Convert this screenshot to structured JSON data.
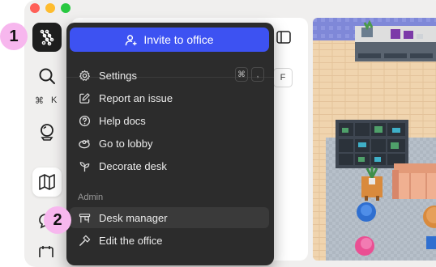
{
  "badges": {
    "one": "1",
    "two": "2"
  },
  "rail": {
    "search_shortcut": {
      "mod": "⌘",
      "key": "K"
    }
  },
  "panel": {
    "hint_key": "F"
  },
  "menu": {
    "invite_label": "Invite to office",
    "items": [
      {
        "label": "Settings",
        "icon": "gear-icon",
        "shortcut": [
          "⌘",
          ","
        ]
      },
      {
        "label": "Report an issue",
        "icon": "edit-square-icon"
      },
      {
        "label": "Help docs",
        "icon": "help-circle-icon"
      },
      {
        "label": "Go to lobby",
        "icon": "lobby-icon"
      },
      {
        "label": "Decorate desk",
        "icon": "sprout-icon"
      }
    ],
    "section_label": "Admin",
    "admin_items": [
      {
        "label": "Desk manager",
        "icon": "desk-icon",
        "highlighted": true
      },
      {
        "label": "Edit the office",
        "icon": "hammer-icon"
      }
    ]
  },
  "colors": {
    "accent": "#3d52f2",
    "menu_bg": "#2c2c2c",
    "badge": "#f7b7ee"
  }
}
